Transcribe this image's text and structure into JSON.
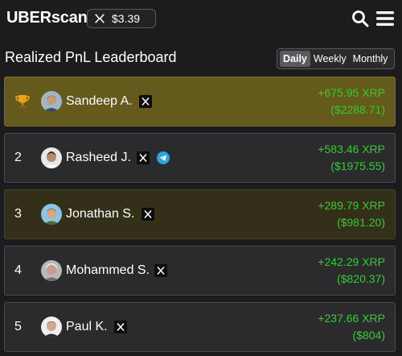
{
  "header": {
    "brand": "UBERscan",
    "token_price": "$3.39",
    "token_icon": "xrp-icon",
    "search_icon": "search-icon",
    "menu_icon": "hamburger-menu-icon"
  },
  "leaderboard": {
    "title": "Realized PnL Leaderboard",
    "periods": [
      "Daily",
      "Weekly",
      "Monthly"
    ],
    "selected_period": "Daily",
    "colors": {
      "positive": "#33cc33",
      "first_row": "#635a1c",
      "highlight_row": "#332f18",
      "row": "#2b2b2e"
    },
    "rows": [
      {
        "rank": "",
        "rank_icon": "trophy-icon",
        "name": "Sandeep A.",
        "socials": [
          "x-icon"
        ],
        "pnl_xrp": "+675.95 XRP",
        "pnl_usd": "($2288.71)"
      },
      {
        "rank": "2",
        "name": "Rasheed J.",
        "socials": [
          "x-icon",
          "telegram-icon"
        ],
        "pnl_xrp": "+583.46 XRP",
        "pnl_usd": "($1975.55)"
      },
      {
        "rank": "3",
        "name": "Jonathan S.",
        "socials": [
          "x-icon"
        ],
        "pnl_xrp": "+289.79 XRP",
        "pnl_usd": "($981.20)"
      },
      {
        "rank": "4",
        "name": "Mohammed S.",
        "socials": [
          "x-icon"
        ],
        "pnl_xrp": "+242.29 XRP",
        "pnl_usd": "($820.37)"
      },
      {
        "rank": "5",
        "name": "Paul K.",
        "socials": [
          "x-icon"
        ],
        "pnl_xrp": "+237.66 XRP",
        "pnl_usd": "($804)"
      }
    ]
  }
}
